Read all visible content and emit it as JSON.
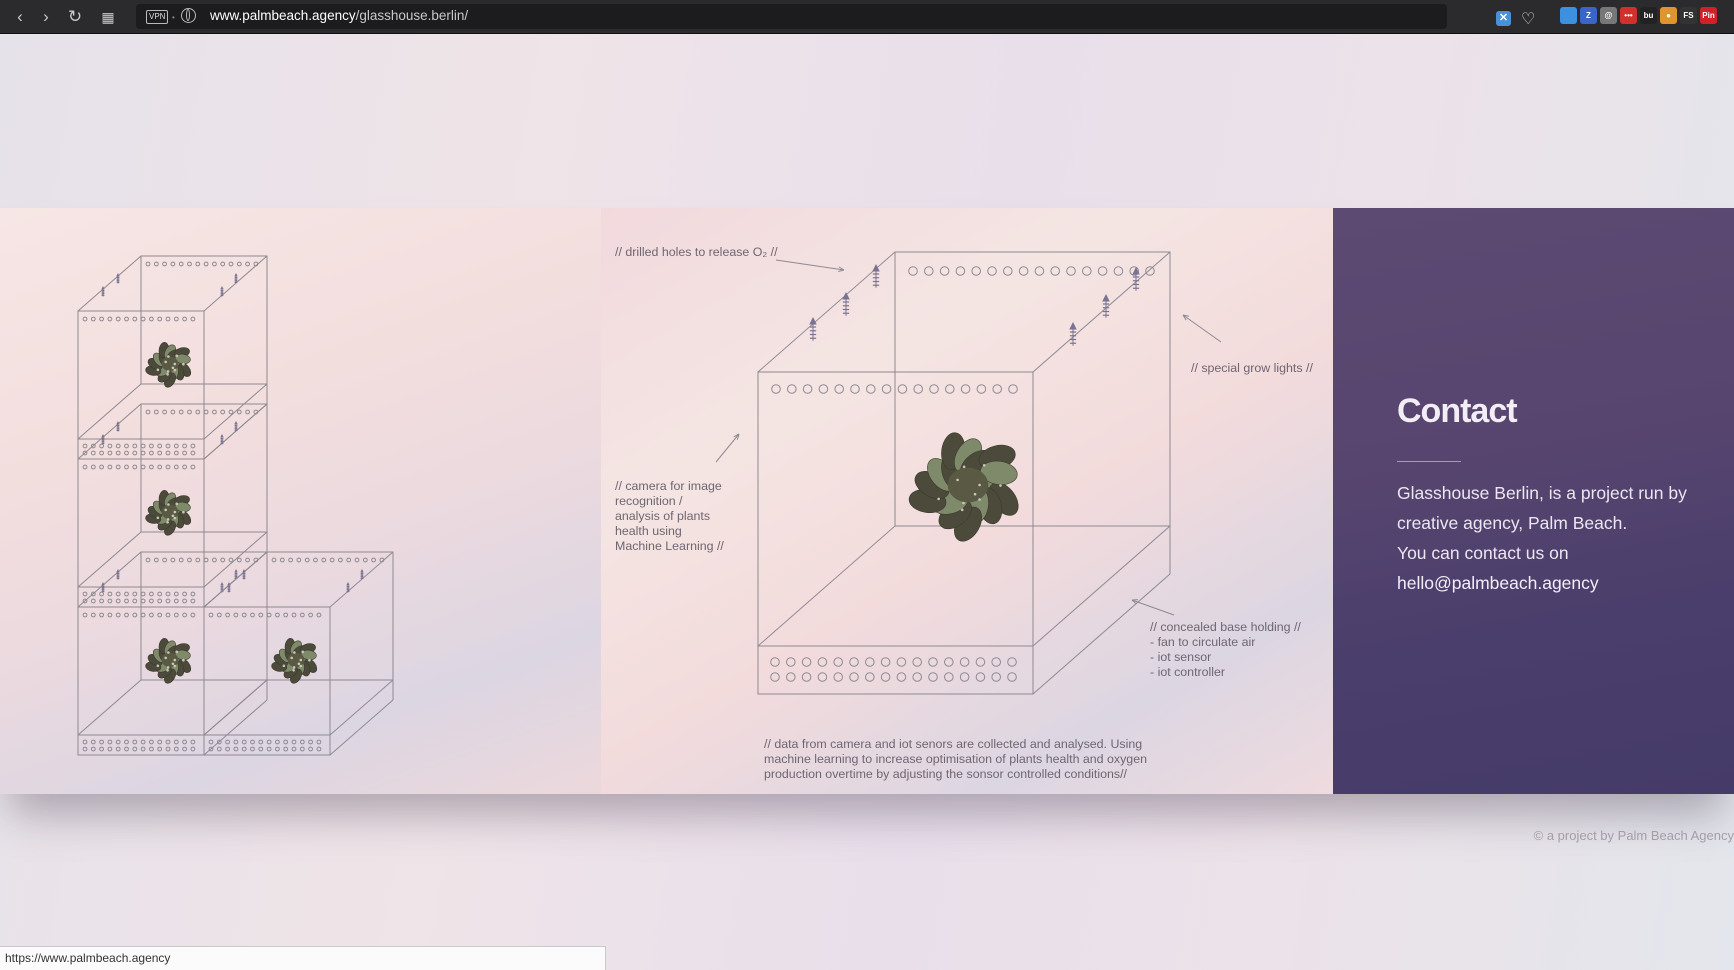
{
  "browser": {
    "vpn_label": "VPN",
    "url_host": "www.palmbeach.agency",
    "url_path": "/glasshouse.berlin/",
    "icons": [
      "back-icon",
      "forward-icon",
      "reload-icon",
      "grid-icon",
      "vpn-badge",
      "globe-icon",
      "extension-icon",
      "heart-icon"
    ],
    "extensions": [
      {
        "name": "blue-extension",
        "label": "",
        "color": "#3d8fe0"
      },
      {
        "name": "z-extension",
        "label": "Z",
        "color": "#3a64c8"
      },
      {
        "name": "circle-extension",
        "label": "@",
        "color": "#777777"
      },
      {
        "name": "dots-extension",
        "label": "•••",
        "color": "#d0312d"
      },
      {
        "name": "bu-extension",
        "label": "bu",
        "color": "#222222"
      },
      {
        "name": "cookie-extension",
        "label": "●",
        "color": "#e0952c"
      },
      {
        "name": "fs-extension",
        "label": "FS",
        "color": "#333333"
      },
      {
        "name": "pin-extension",
        "label": "Pin",
        "color": "#d0212b"
      }
    ]
  },
  "diagram": {
    "annotations": {
      "drilled_holes": "// drilled holes to release O₂ //",
      "grow_lights": "// special grow lights //",
      "camera": [
        "// camera for image",
        "recognition /",
        "analysis of plants",
        "health using",
        "Machine Learning //"
      ],
      "base": [
        "// concealed base holding //",
        "- fan to circulate air",
        "- iot sensor",
        "- iot controller"
      ],
      "data": [
        "// data  from camera and iot senors are collected and analysed. Using",
        "machine learning to increase optimisation of plants health and  oxygen",
        "production overtime by adjusting the sonsor controlled conditions//"
      ]
    },
    "colors": {
      "line": "#8e8a92",
      "lamp": "#7a7291",
      "leaf_dark": "#4c4a3a",
      "leaf_light": "#7f8a6a"
    }
  },
  "contact": {
    "title": "Contact",
    "lines": [
      "Glasshouse Berlin, is a project run by",
      "creative agency, Palm Beach.",
      "You can contact us on"
    ],
    "email": "hello@palmbeach.agency"
  },
  "footer": {
    "credit": "© a project by Palm Beach Agency"
  },
  "status_bar": {
    "url": "https://www.palmbeach.agency"
  }
}
